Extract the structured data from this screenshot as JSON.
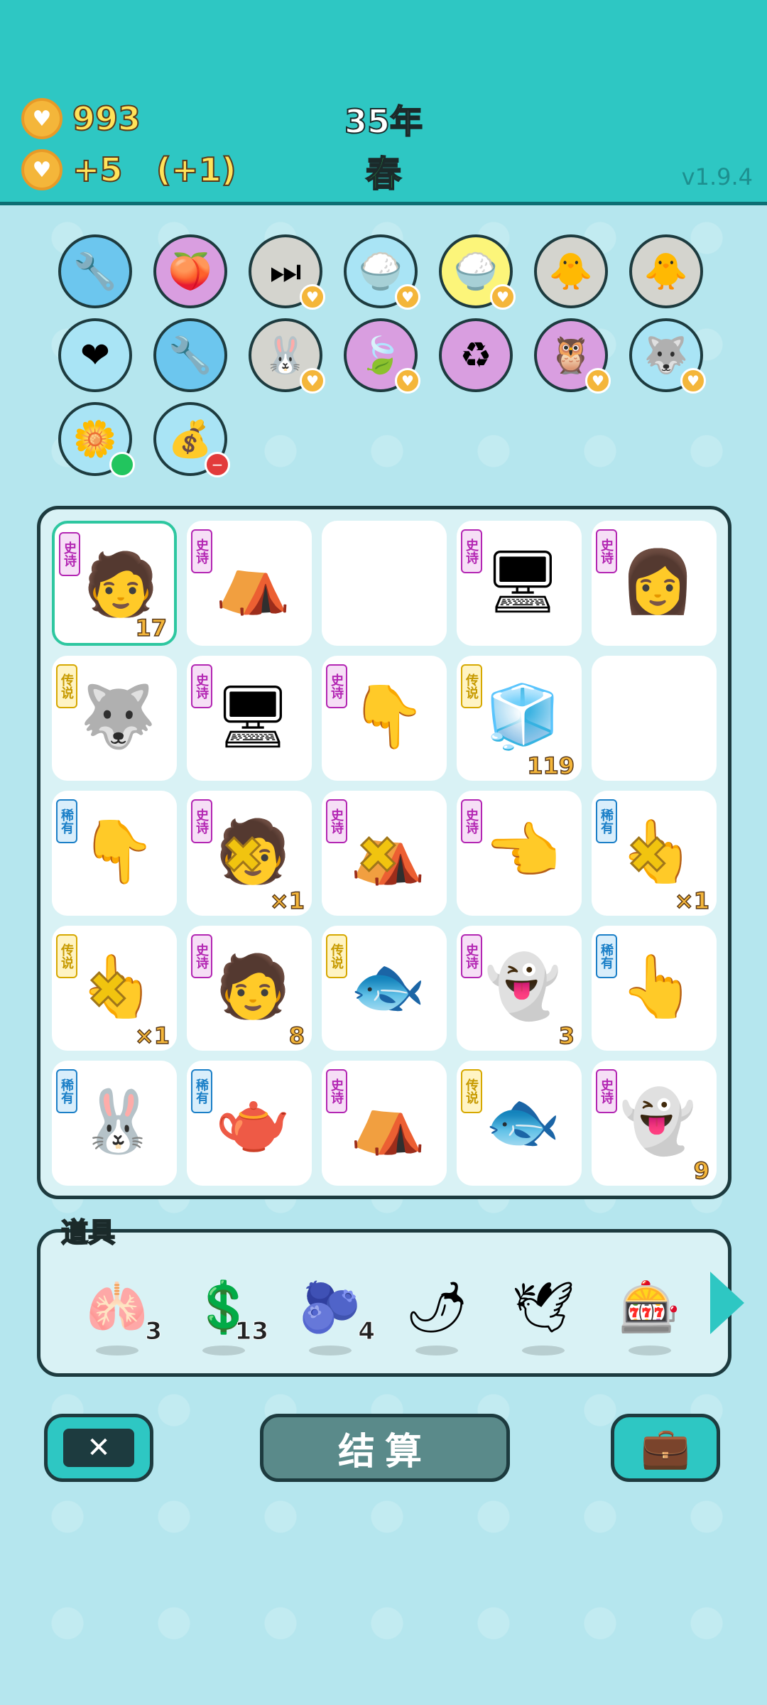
{
  "header": {
    "coins": "993",
    "income": "+5",
    "bonus": "(+1)",
    "year": "35年",
    "season": "春",
    "version": "v1.9.4"
  },
  "relics": [
    {
      "icon": "🔧",
      "bg": "#6cc6ee",
      "badge": ""
    },
    {
      "icon": "🍑",
      "bg": "#d99ee0",
      "badge": ""
    },
    {
      "icon": "⏭",
      "bg": "#d4d4ce",
      "badge": "heart"
    },
    {
      "icon": "🍚",
      "bg": "#a9e4f5",
      "badge": "heart"
    },
    {
      "icon": "🍚",
      "bg": "#fcf57a",
      "badge": "heart"
    },
    {
      "icon": "🐥",
      "bg": "#d4d4ce",
      "badge": ""
    },
    {
      "icon": "🐥",
      "bg": "#d4d4ce",
      "badge": ""
    },
    {
      "icon": "❤",
      "bg": "#a9e4f5",
      "badge": ""
    },
    {
      "icon": "🔧",
      "bg": "#6cc6ee",
      "badge": ""
    },
    {
      "icon": "🐰",
      "bg": "#d4d4ce",
      "badge": "heart"
    },
    {
      "icon": "🍃",
      "bg": "#d99ee0",
      "badge": "heart"
    },
    {
      "icon": "♻",
      "bg": "#d99ee0",
      "badge": ""
    },
    {
      "icon": "🦉",
      "bg": "#d99ee0",
      "badge": "heart"
    },
    {
      "icon": "🐺",
      "bg": "#a9e4f5",
      "badge": "heart"
    },
    {
      "icon": "🌼",
      "bg": "#a9e4f5",
      "badge": "green"
    },
    {
      "icon": "💰",
      "bg": "#a9e4f5",
      "badge": "red"
    }
  ],
  "board": [
    {
      "tag": "史诗",
      "tagType": "epic",
      "icon": "🧑",
      "count": "17",
      "sel": true,
      "x": false
    },
    {
      "tag": "史诗",
      "tagType": "epic",
      "icon": "⛺",
      "count": "",
      "sel": false,
      "x": false
    },
    {
      "tag": "",
      "tagType": "",
      "icon": "",
      "count": "",
      "sel": false,
      "x": false
    },
    {
      "tag": "史诗",
      "tagType": "epic",
      "icon": "🖥",
      "count": "",
      "sel": false,
      "x": false
    },
    {
      "tag": "史诗",
      "tagType": "epic",
      "icon": "👩",
      "count": "",
      "sel": false,
      "x": false
    },
    {
      "tag": "传说",
      "tagType": "leg",
      "icon": "🐺",
      "count": "",
      "sel": false,
      "x": false
    },
    {
      "tag": "史诗",
      "tagType": "epic",
      "icon": "🖥",
      "count": "",
      "sel": false,
      "x": false
    },
    {
      "tag": "史诗",
      "tagType": "epic",
      "icon": "👇",
      "count": "",
      "sel": false,
      "x": false
    },
    {
      "tag": "传说",
      "tagType": "leg",
      "icon": "🧊",
      "count": "119",
      "sel": false,
      "x": false
    },
    {
      "tag": "",
      "tagType": "",
      "icon": "",
      "count": "",
      "sel": false,
      "x": false
    },
    {
      "tag": "稀有",
      "tagType": "rare",
      "icon": "👇",
      "count": "",
      "sel": false,
      "x": false
    },
    {
      "tag": "史诗",
      "tagType": "epic",
      "icon": "🧑",
      "count": "×1",
      "sel": false,
      "x": true
    },
    {
      "tag": "史诗",
      "tagType": "epic",
      "icon": "⛺",
      "count": "",
      "sel": false,
      "x": true
    },
    {
      "tag": "史诗",
      "tagType": "epic",
      "icon": "👈",
      "count": "",
      "sel": false,
      "x": false
    },
    {
      "tag": "稀有",
      "tagType": "rare",
      "icon": "👆",
      "count": "×1",
      "sel": false,
      "x": true
    },
    {
      "tag": "传说",
      "tagType": "leg",
      "icon": "👆",
      "count": "×1",
      "sel": false,
      "x": true
    },
    {
      "tag": "史诗",
      "tagType": "epic",
      "icon": "🧑",
      "count": "8",
      "sel": false,
      "x": false
    },
    {
      "tag": "传说",
      "tagType": "leg",
      "icon": "🐟",
      "count": "",
      "sel": false,
      "x": false
    },
    {
      "tag": "史诗",
      "tagType": "epic",
      "icon": "👻",
      "count": "3",
      "sel": false,
      "x": false
    },
    {
      "tag": "稀有",
      "tagType": "rare",
      "icon": "👆",
      "count": "",
      "sel": false,
      "x": false
    },
    {
      "tag": "稀有",
      "tagType": "rare",
      "icon": "🐰",
      "count": "",
      "sel": false,
      "x": false
    },
    {
      "tag": "稀有",
      "tagType": "rare",
      "icon": "🫖",
      "count": "",
      "sel": false,
      "x": false
    },
    {
      "tag": "史诗",
      "tagType": "epic",
      "icon": "⛺",
      "count": "",
      "sel": false,
      "x": false
    },
    {
      "tag": "传说",
      "tagType": "leg",
      "icon": "🐟",
      "count": "",
      "sel": false,
      "x": false
    },
    {
      "tag": "史诗",
      "tagType": "epic",
      "icon": "👻",
      "count": "9",
      "sel": false,
      "x": false
    }
  ],
  "tools": {
    "title": "道具",
    "items": [
      {
        "icon": "🫁",
        "count": "3"
      },
      {
        "icon": "💲",
        "count": "13"
      },
      {
        "icon": "🫐",
        "count": "4"
      },
      {
        "icon": "🌶",
        "count": ""
      },
      {
        "icon": "🕊",
        "count": ""
      },
      {
        "icon": "🎰",
        "count": ""
      }
    ]
  },
  "buttons": {
    "close": "✕",
    "settle": "结算",
    "bag": "💼"
  }
}
